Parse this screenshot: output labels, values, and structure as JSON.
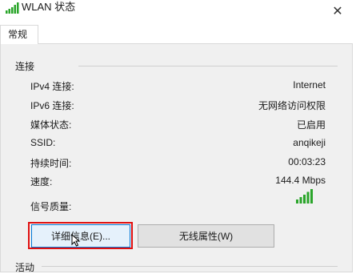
{
  "window": {
    "title": "WLAN 状态",
    "close_glyph": "✕"
  },
  "tabs": [
    {
      "label": "常规"
    }
  ],
  "connection": {
    "group_label": "连接",
    "rows": [
      {
        "label": "IPv4 连接:",
        "value": "Internet"
      },
      {
        "label": "IPv6 连接:",
        "value": "无网络访问权限"
      },
      {
        "label": "媒体状态:",
        "value": "已启用"
      },
      {
        "label": "SSID:",
        "value": "anqikeji"
      },
      {
        "label": "持续时间:",
        "value": "00:03:23"
      },
      {
        "label": "速度:",
        "value": "144.4 Mbps"
      }
    ],
    "signal_label": "信号质量:",
    "signal_bars": 5,
    "signal_color": "#2aa52a"
  },
  "buttons": {
    "details": "详细信息(E)...",
    "wireless_properties": "无线属性(W)"
  },
  "activity": {
    "group_label": "活动"
  },
  "colors": {
    "highlight": "#e01010",
    "focus_border": "#0078d7"
  }
}
